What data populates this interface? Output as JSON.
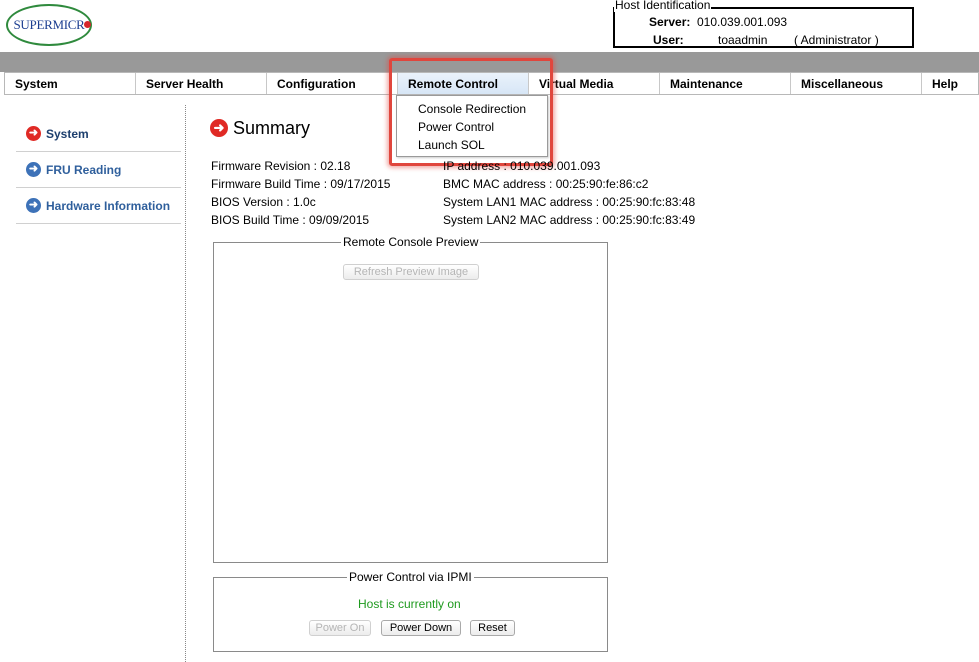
{
  "logo": {
    "text": "SUPERMICR"
  },
  "host": {
    "legend": "Host Identification",
    "server_label": "Server:",
    "server_value": "010.039.001.093",
    "user_label": "User:",
    "user_value": "toaadmin",
    "role": "( Administrator )"
  },
  "menu": {
    "items": [
      {
        "label": "System"
      },
      {
        "label": "Server Health"
      },
      {
        "label": "Configuration"
      },
      {
        "label": "Remote Control"
      },
      {
        "label": "Virtual Media"
      },
      {
        "label": "Maintenance"
      },
      {
        "label": "Miscellaneous"
      },
      {
        "label": "Help"
      }
    ],
    "dropdown": [
      "Console Redirection",
      "Power Control",
      "Launch SOL"
    ]
  },
  "sidebar": {
    "items": [
      {
        "label": "System",
        "icon": "arrow-right-icon",
        "color": "#e02a25"
      },
      {
        "label": "FRU Reading",
        "icon": "arrow-right-icon",
        "color": "#3d72b8"
      },
      {
        "label": "Hardware Information",
        "icon": "arrow-right-icon",
        "color": "#3d72b8"
      }
    ]
  },
  "summary": {
    "title": "Summary",
    "firmware_revision": "Firmware Revision :  02.18",
    "firmware_build": "Firmware Build Time :  09/17/2015",
    "bios_version": "BIOS Version : 1.0c",
    "bios_build": "BIOS Build Time : 09/09/2015",
    "ip": "IP address :  010.039.001.093",
    "bmc_mac": "BMC MAC address :  00:25:90:fe:86:c2",
    "lan1_mac": "System LAN1 MAC address : 00:25:90:fc:83:48",
    "lan2_mac": "System LAN2 MAC address : 00:25:90:fc:83:49"
  },
  "console_preview": {
    "legend": "Remote Console Preview",
    "refresh_label": "Refresh Preview Image"
  },
  "power": {
    "legend": "Power Control via IPMI",
    "status": "Host is currently on",
    "status_color": "#1f9a1f",
    "power_on": "Power On",
    "power_down": "Power Down",
    "reset": "Reset"
  },
  "colors": {
    "header_band": "#999999",
    "highlight": "#e0463d",
    "link_blue": "#2f5f9c"
  }
}
